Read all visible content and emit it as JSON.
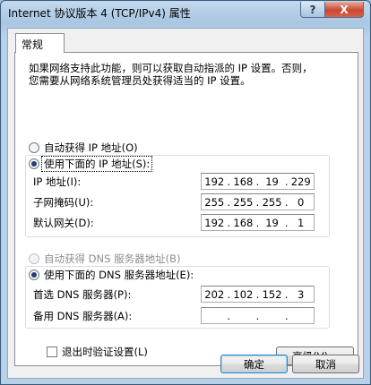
{
  "window": {
    "title": "Internet 协议版本 4 (TCP/IPv4) 属性",
    "help_label": "?",
    "close_label": "X"
  },
  "tabs": [
    {
      "label": "常规"
    }
  ],
  "description": {
    "line1": "如果网络支持此功能，则可以获取自动指派的 IP 设置。否则，",
    "line2": "您需要从网络系统管理员处获得适当的 IP 设置。"
  },
  "ip": {
    "auto_label": "自动获得 IP 地址(O)",
    "manual_label": "使用下面的 IP 地址(S):",
    "selected": "manual",
    "fields": [
      {
        "label": "IP 地址(I):",
        "octets": [
          "192",
          "168",
          "19",
          "229"
        ]
      },
      {
        "label": "子网掩码(U):",
        "octets": [
          "255",
          "255",
          "255",
          "0"
        ]
      },
      {
        "label": "默认网关(D):",
        "octets": [
          "192",
          "168",
          "19",
          "1"
        ]
      }
    ]
  },
  "dns": {
    "auto_label": "自动获得 DNS 服务器地址(B)",
    "manual_label": "使用下面的 DNS 服务器地址(E):",
    "selected": "manual",
    "fields": [
      {
        "label": "首选 DNS 服务器(P):",
        "octets": [
          "202",
          "102",
          "152",
          "3"
        ]
      },
      {
        "label": "备用 DNS 服务器(A):",
        "octets": [
          "",
          "",
          "",
          ""
        ]
      }
    ]
  },
  "validate": {
    "label": "退出时验证设置(L)",
    "checked": false
  },
  "buttons": {
    "advanced": "高级(V)...",
    "ok": "确定",
    "cancel": "取消"
  }
}
